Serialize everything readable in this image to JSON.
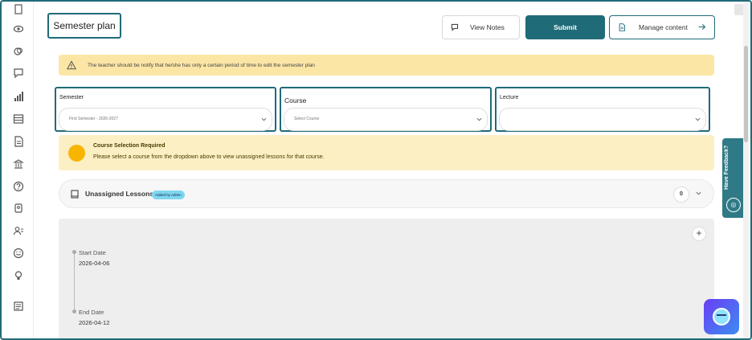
{
  "page": {
    "title": "Semester plan"
  },
  "header_buttons": {
    "view_notes": "View Notes",
    "submit": "Submit",
    "manage_content": "Manage content"
  },
  "warning": {
    "text": "The teacher should be notify that he/she has only a certain period of time to edit the semester plan"
  },
  "selectors": {
    "semester": {
      "label": "Semester",
      "value": "First Semester - 2026-2027"
    },
    "course": {
      "label": "Course",
      "value": "Select Course"
    },
    "lecture": {
      "label": "Lecture",
      "value": ""
    }
  },
  "info": {
    "title": "Course Selection Required",
    "message": "Please select a course from the dropdown above to view unassigned lessons for that course."
  },
  "lessons": {
    "title": "Unassigned Lessons",
    "badge": "Added by Admin",
    "count": "0"
  },
  "timeline": {
    "start_label": "Start Date",
    "start_value": "2026-04-06",
    "end_label": "End Date",
    "end_value": "2026-04-12",
    "add_symbol": "+"
  },
  "feedback": {
    "label": "Have Feedback?"
  },
  "sidebar_icons": [
    "book-icon",
    "eye-icon",
    "layers-icon",
    "chat-icon",
    "bar-chart-icon",
    "table-icon",
    "document-icon",
    "bank-icon",
    "help-icon",
    "tag-icon",
    "users-icon",
    "smile-icon",
    "bulb-icon",
    "notes-icon"
  ],
  "colors": {
    "primary": "#1f6b78",
    "warning_bg": "#fbe6a6",
    "info_bg": "#fcefc4",
    "info_dot": "#f7b500",
    "badge": "#7fd7f0"
  }
}
